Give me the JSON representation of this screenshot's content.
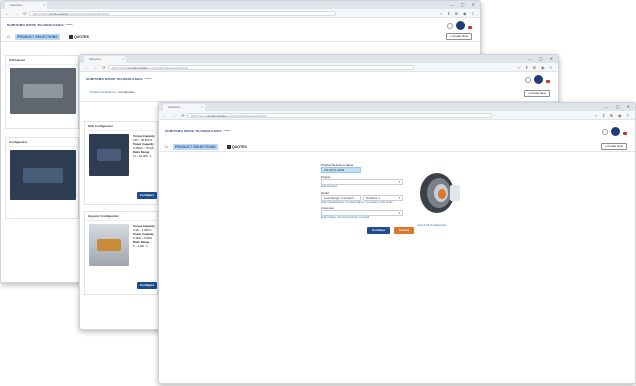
{
  "browser": {
    "tab_title": "Selection",
    "tab_close": "×",
    "window_controls": "— ▢ ✕",
    "nav_buttons": "← → ⟳ ⌂",
    "url_prefix": "https://www.",
    "url_domain": "sumitomodrive",
    "url_suffix": ".com/ptc/productselection/new",
    "toolbar_icons": "☆ ⫴ ⊞ ◉ ≡"
  },
  "app": {
    "brand": "SUMITOMO DRIVE TECHNOLOGIES",
    "home_icon": "⌂",
    "nav_product_selections": "PRODUCT SELECTIONS",
    "nav_quotes": "QUOTES",
    "create_new": "+ Create New"
  },
  "window1": {
    "panel1_title": "U30 Hexset",
    "panel2_title": "Configurator"
  },
  "window2": {
    "breadcrumb_root": "Product Selections",
    "breadcrumb_sep": ">",
    "breadcrumb_current": "Configurator",
    "card1": {
      "title": "SSS Configurator",
      "spec_torque_label": "Torque Capacity",
      "spec_torque_value": "135 ~ 38,600 N",
      "spec_power_label": "Power Capacity",
      "spec_power_value": "0.25kW ~ 75 kW",
      "spec_ratio_label": "Ratio Range",
      "spec_ratio_value": "11 ~ 10,000 : 1",
      "button": "Configure"
    },
    "card2": {
      "title": "Hyponic Configurator",
      "spec_torque_label": "Torque Capacity",
      "spec_torque_value": "4.49 ~ 1,048 N",
      "spec_power_label": "Power Capacity",
      "spec_power_value": "0.1kW ~ 5.5kW",
      "spec_ratio_label": "Ratio Range",
      "spec_ratio_value": "5 ~ 1440 : 1",
      "button": "Configure"
    }
  },
  "window3": {
    "form": {
      "name_label": "Product Selection Name",
      "name_value": "CS-SS71-1863",
      "project_label": "Project",
      "project_link": "Enter Project",
      "detail_label": "Detail",
      "detail_value_1": "Low Range / Constant",
      "detail_value_2": "Gearbox 1",
      "detail_note": "Enter Detail Name / Contact Name / Company or ID Code",
      "customer_label": "Customer",
      "customer_note": "Enter Name, Account Number or Email",
      "caret": "▾",
      "continue": "Continue",
      "cancel": "Cancel"
    },
    "product_link": "View Full Configurator"
  }
}
